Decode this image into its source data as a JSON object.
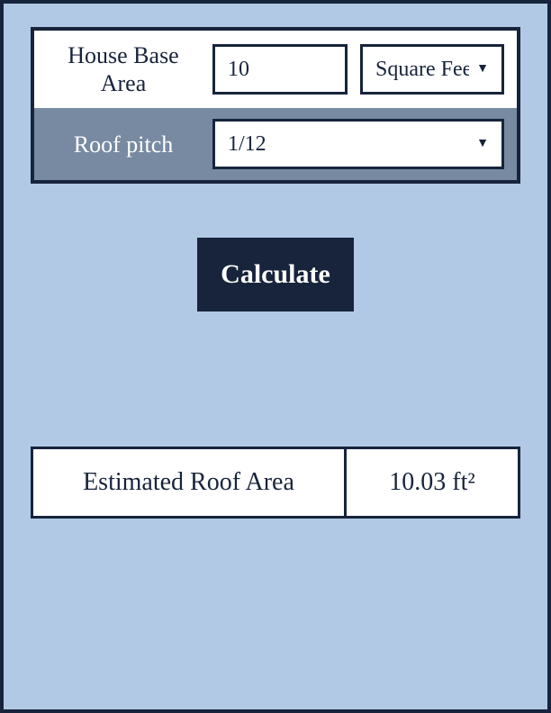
{
  "inputs": {
    "house_base_area": {
      "label": "House Base Area",
      "value": "10",
      "unit_selected": "Square Feet"
    },
    "roof_pitch": {
      "label": "Roof pitch",
      "selected": "1/12"
    }
  },
  "actions": {
    "calculate_label": "Calculate"
  },
  "result": {
    "label": "Estimated Roof Area",
    "value": "10.03 ft²"
  }
}
